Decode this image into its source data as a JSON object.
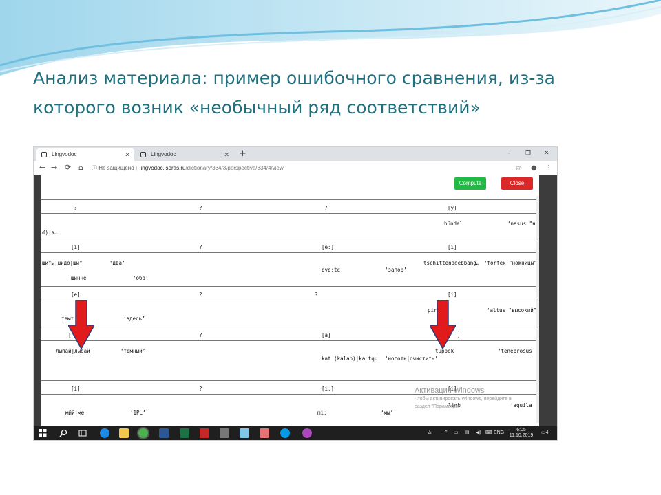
{
  "slide": {
    "title_line1": "Анализ материала: пример  ошибочного сравнения, из-за",
    "title_line2": "которого возник «необычный ряд соответствий»"
  },
  "browser": {
    "tabs": [
      {
        "label": "Lingvodoc",
        "active": true
      },
      {
        "label": "Lingvodoc",
        "active": false
      }
    ],
    "new_tab": "+",
    "window_controls": [
      "–",
      "❐",
      "✕"
    ],
    "nav": {
      "back": "←",
      "forward": "→",
      "reload": "⟳",
      "home": "⌂"
    },
    "address": {
      "security": "ⓘ Не защищено",
      "host": "lingvodoc.ispras.ru",
      "path": "/dictionary/334/3/perspective/334/4/view"
    },
    "toolbar": {
      "star": "☆",
      "account": "●",
      "menu": "⋮"
    }
  },
  "page": {
    "compute_label": "Compute",
    "close_label": "Close",
    "rows": [
      {
        "c1": "?",
        "c2": "?",
        "c3": "?",
        "c4": "[y]"
      },
      {
        "left": "ɗ)|в…",
        "right_word": "hündel",
        "right_gloss": "‘nasus \"н"
      },
      {
        "c1": "[i]",
        "c2": "?",
        "c3": "[eː]",
        "c4": "[i]"
      },
      {
        "left_word": "шиты|шидо|шит",
        "left_gloss": "‘два’",
        "left_word2": "шинне",
        "left_gloss2": "‘оба’",
        "mid_word": "qveːtɛ",
        "mid_gloss": "‘запор’",
        "right_word": "tschittenädebbang…",
        "right_gloss": "‘forfex \"ножницы\""
      },
      {
        "c1": "[e]",
        "c2": "?",
        "c3": "?",
        "c4": "[i]"
      },
      {
        "left_word": "темт",
        "left_gloss": "‘здесь’",
        "right_word": "pir",
        "right_gloss": "‘altus \"высокий\""
      },
      {
        "c1": "[",
        "c2": "?",
        "c3": "[a]",
        "c4": "]"
      },
      {
        "left_word": "лыпай|лыбай",
        "left_gloss": "‘темный’",
        "mid_word": "kat (kalȧn)|kaːtqu",
        "mid_gloss": "‘ноготь|очистить’",
        "right_word": "tüppok",
        "right_gloss": "‘tenebrosus"
      },
      {
        "c1": "[i]",
        "c2": "?",
        "c3": "[iː]",
        "c4": "[i]"
      },
      {
        "left_word": "мӣй|ме",
        "left_gloss": "‘1PL’",
        "mid_word": "miː",
        "mid_gloss": "‘мы’",
        "right_word": "limb",
        "right_gloss": "‘aquila"
      }
    ],
    "activation_title": "Активация Windows",
    "activation_line1": "Чтобы активировать Windows, перейдите в",
    "activation_line2": "раздел \"Параметры\"."
  },
  "taskbar": {
    "tray_text": "ENG",
    "time": "6:05",
    "date": "11.10.2019",
    "notifications": "4"
  },
  "colors": {
    "title": "#1f6f7f",
    "compute": "#21ba45",
    "close": "#db2828",
    "arrow": "#e11b1b"
  }
}
